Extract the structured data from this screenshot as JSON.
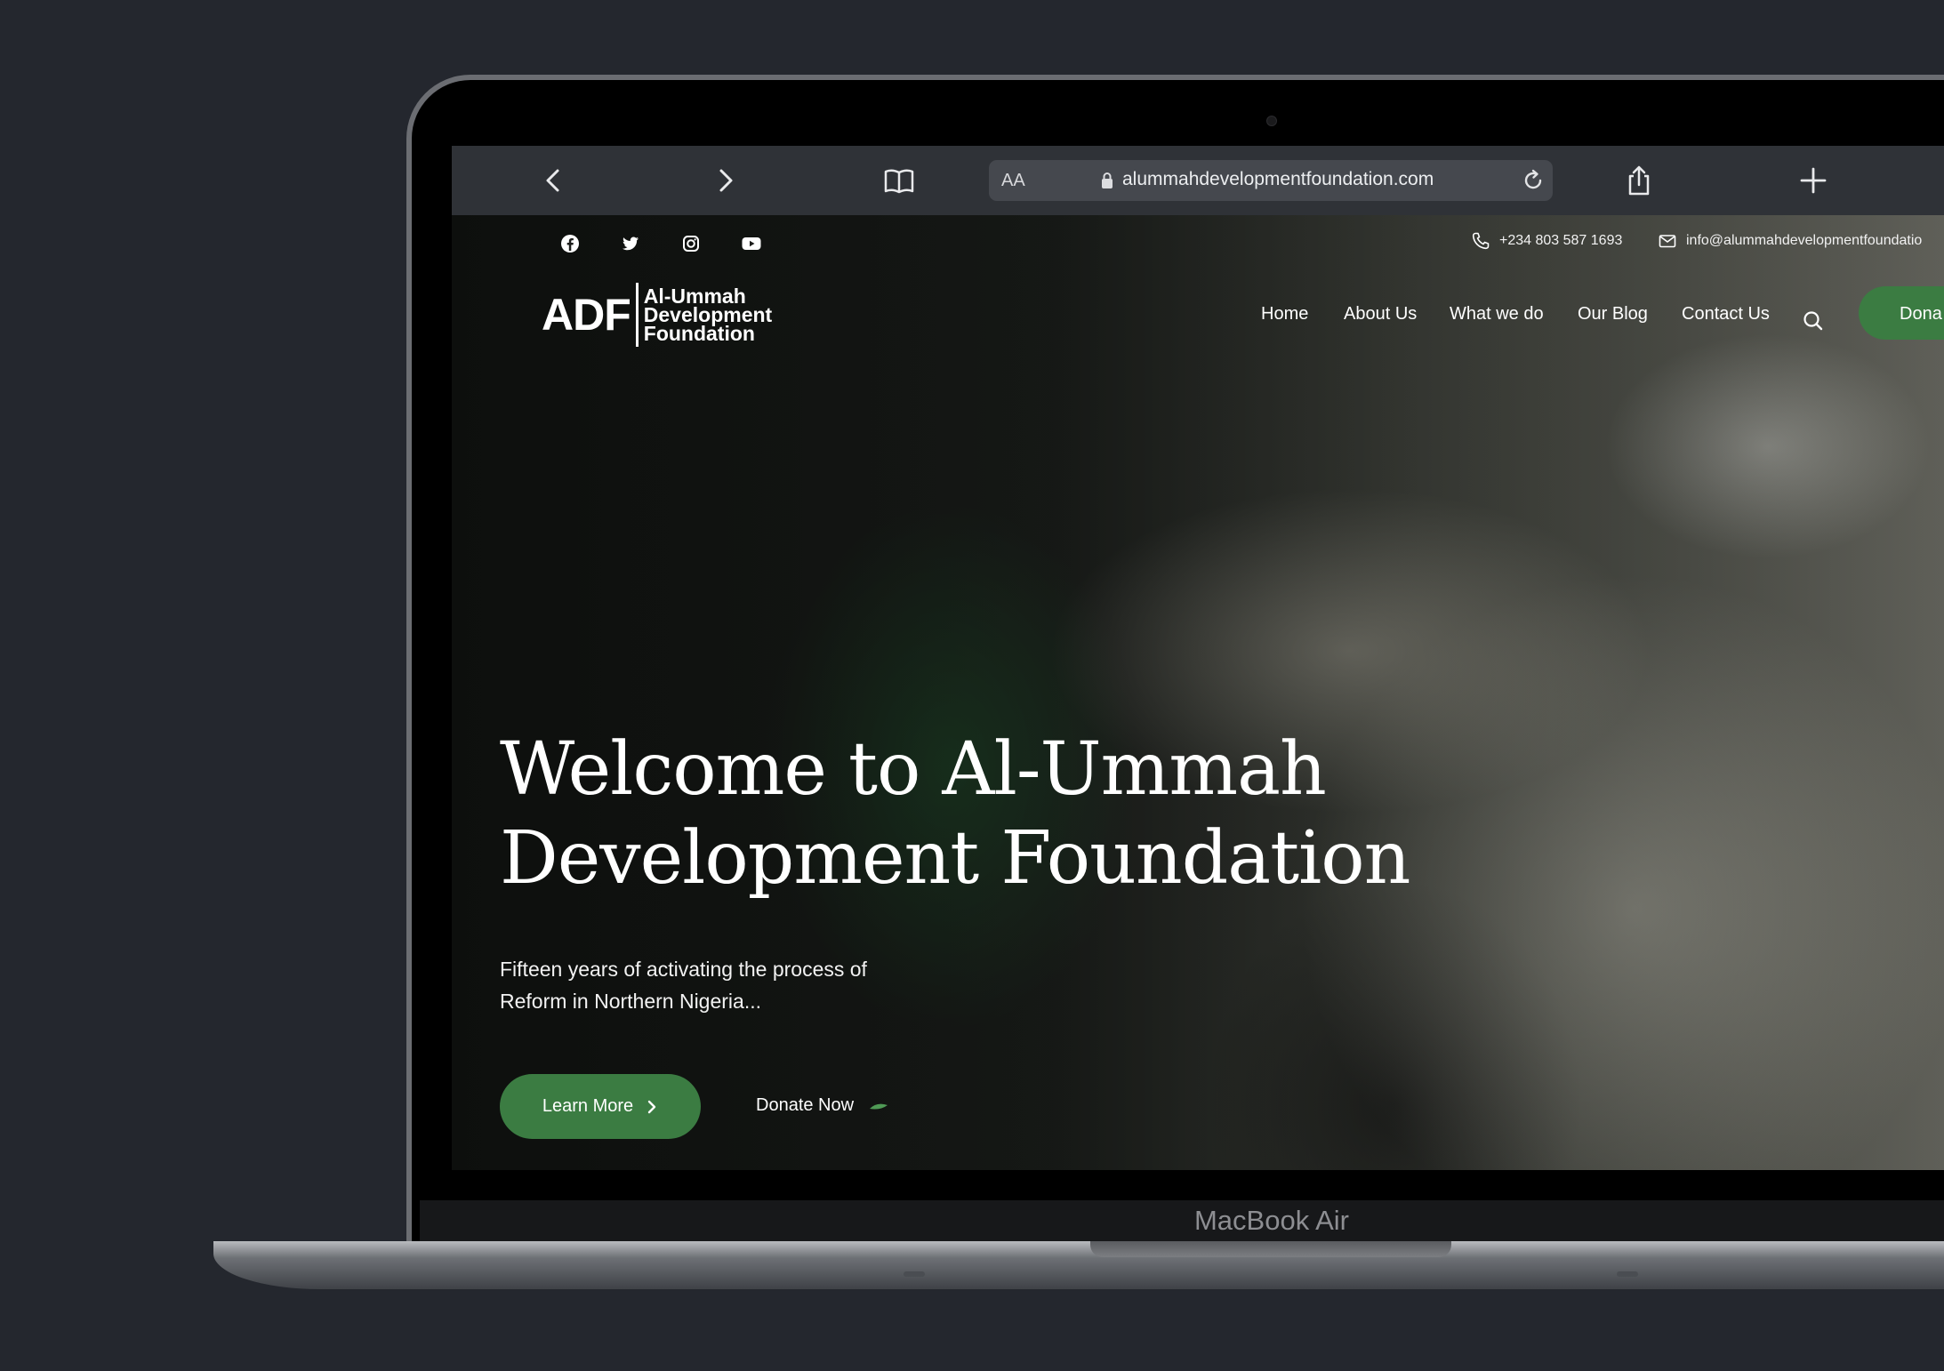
{
  "device": {
    "model_label": "MacBook Air"
  },
  "browser": {
    "reader_label": "AA",
    "url": "alummahdevelopmentfoundation.com"
  },
  "topbar": {
    "social": [
      "facebook-icon",
      "twitter-icon",
      "instagram-icon",
      "youtube-icon"
    ],
    "phone": "+234 803 587 1693",
    "email": "info@alummahdevelopmentfoundatio"
  },
  "logo": {
    "mark": "ADF",
    "line1": "Al-Ummah",
    "line2": "Development",
    "line3": "Foundation"
  },
  "nav": {
    "items": [
      "Home",
      "About Us",
      "What we do",
      "Our Blog",
      "Contact Us"
    ],
    "donate_label": "Dona"
  },
  "hero": {
    "title_line1": "Welcome to Al-Ummah",
    "title_line2": "Development Foundation",
    "subtitle_line1": "Fifteen years of activating the process of",
    "subtitle_line2": "Reform in Northern Nigeria...",
    "learn_more_label": "Learn More",
    "donate_now_label": "Donate Now"
  },
  "colors": {
    "accent_green": "#3b7c42",
    "background": "#24272e"
  }
}
